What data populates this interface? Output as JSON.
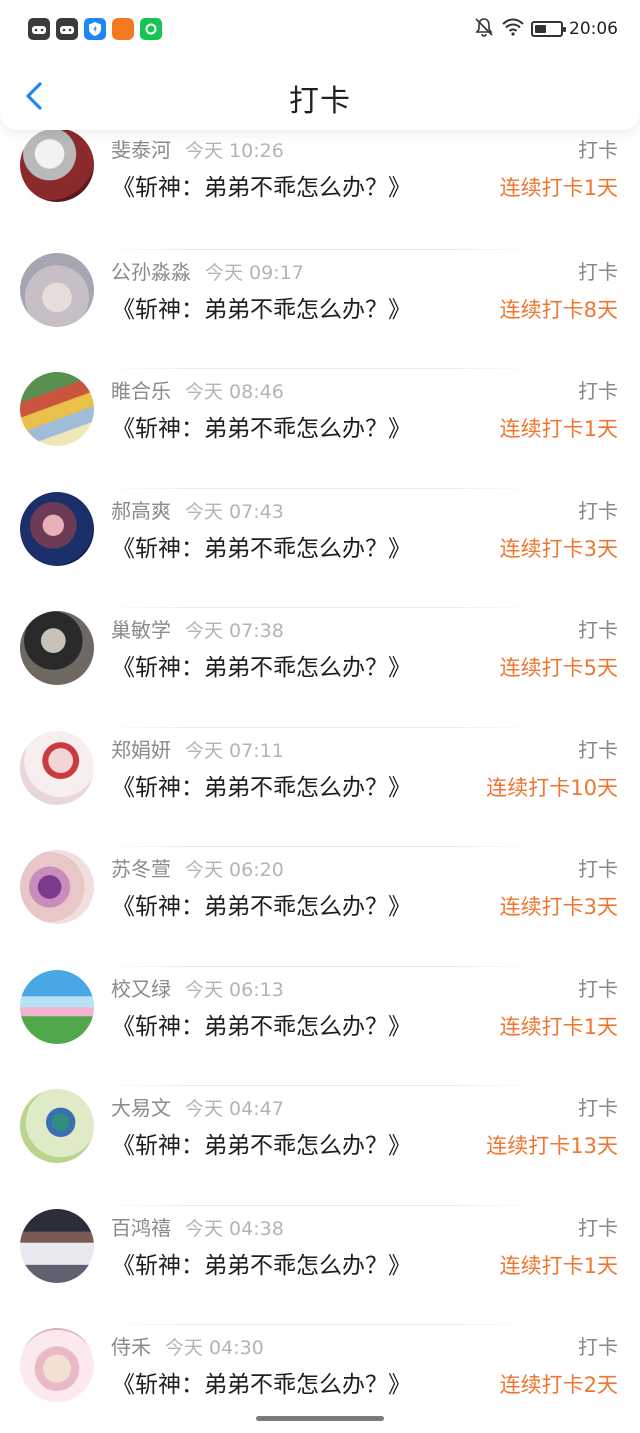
{
  "status_bar": {
    "time": "20:06",
    "app_icons": [
      "game-controller-icon",
      "game-controller-icon",
      "shield-icon",
      "orange-app-icon",
      "camera-icon"
    ],
    "right_icons": [
      "notifications-off-icon",
      "wifi-icon",
      "battery-icon"
    ],
    "battery_percent": 35
  },
  "header": {
    "title": "打卡",
    "back_icon": "chevron-left-icon",
    "accent_color": "#1f86f5"
  },
  "colors": {
    "streak": "#f0762f",
    "name": "#8a8a8a",
    "time": "#b4b4b4"
  },
  "items": [
    {
      "name": "斐泰河",
      "time": "今天 10:26",
      "title": "《斩神：弟弟不乖怎么办？》",
      "action": "打卡",
      "streak": "连续打卡1天",
      "avatar": "avatar-icon"
    },
    {
      "name": "公孙淼淼",
      "time": "今天 09:17",
      "title": "《斩神：弟弟不乖怎么办？》",
      "action": "打卡",
      "streak": "连续打卡8天",
      "avatar": "avatar-icon"
    },
    {
      "name": "睢合乐",
      "time": "今天 08:46",
      "title": "《斩神：弟弟不乖怎么办？》",
      "action": "打卡",
      "streak": "连续打卡1天",
      "avatar": "avatar-icon"
    },
    {
      "name": "郝高爽",
      "time": "今天 07:43",
      "title": "《斩神：弟弟不乖怎么办？》",
      "action": "打卡",
      "streak": "连续打卡3天",
      "avatar": "avatar-icon"
    },
    {
      "name": "巢敏学",
      "time": "今天 07:38",
      "title": "《斩神：弟弟不乖怎么办？》",
      "action": "打卡",
      "streak": "连续打卡5天",
      "avatar": "avatar-icon"
    },
    {
      "name": "郑娟妍",
      "time": "今天 07:11",
      "title": "《斩神：弟弟不乖怎么办？》",
      "action": "打卡",
      "streak": "连续打卡10天",
      "avatar": "avatar-icon"
    },
    {
      "name": "苏冬萱",
      "time": "今天 06:20",
      "title": "《斩神：弟弟不乖怎么办？》",
      "action": "打卡",
      "streak": "连续打卡3天",
      "avatar": "avatar-icon"
    },
    {
      "name": "校又绿",
      "time": "今天 06:13",
      "title": "《斩神：弟弟不乖怎么办？》",
      "action": "打卡",
      "streak": "连续打卡1天",
      "avatar": "avatar-icon"
    },
    {
      "name": "大易文",
      "time": "今天 04:47",
      "title": "《斩神：弟弟不乖怎么办？》",
      "action": "打卡",
      "streak": "连续打卡13天",
      "avatar": "avatar-icon"
    },
    {
      "name": "百鸿禧",
      "time": "今天 04:38",
      "title": "《斩神：弟弟不乖怎么办？》",
      "action": "打卡",
      "streak": "连续打卡1天",
      "avatar": "avatar-icon"
    },
    {
      "name": "侍禾",
      "time": "今天 04:30",
      "title": "《斩神：弟弟不乖怎么办？》",
      "action": "打卡",
      "streak": "连续打卡2天",
      "avatar": "avatar-icon"
    }
  ]
}
